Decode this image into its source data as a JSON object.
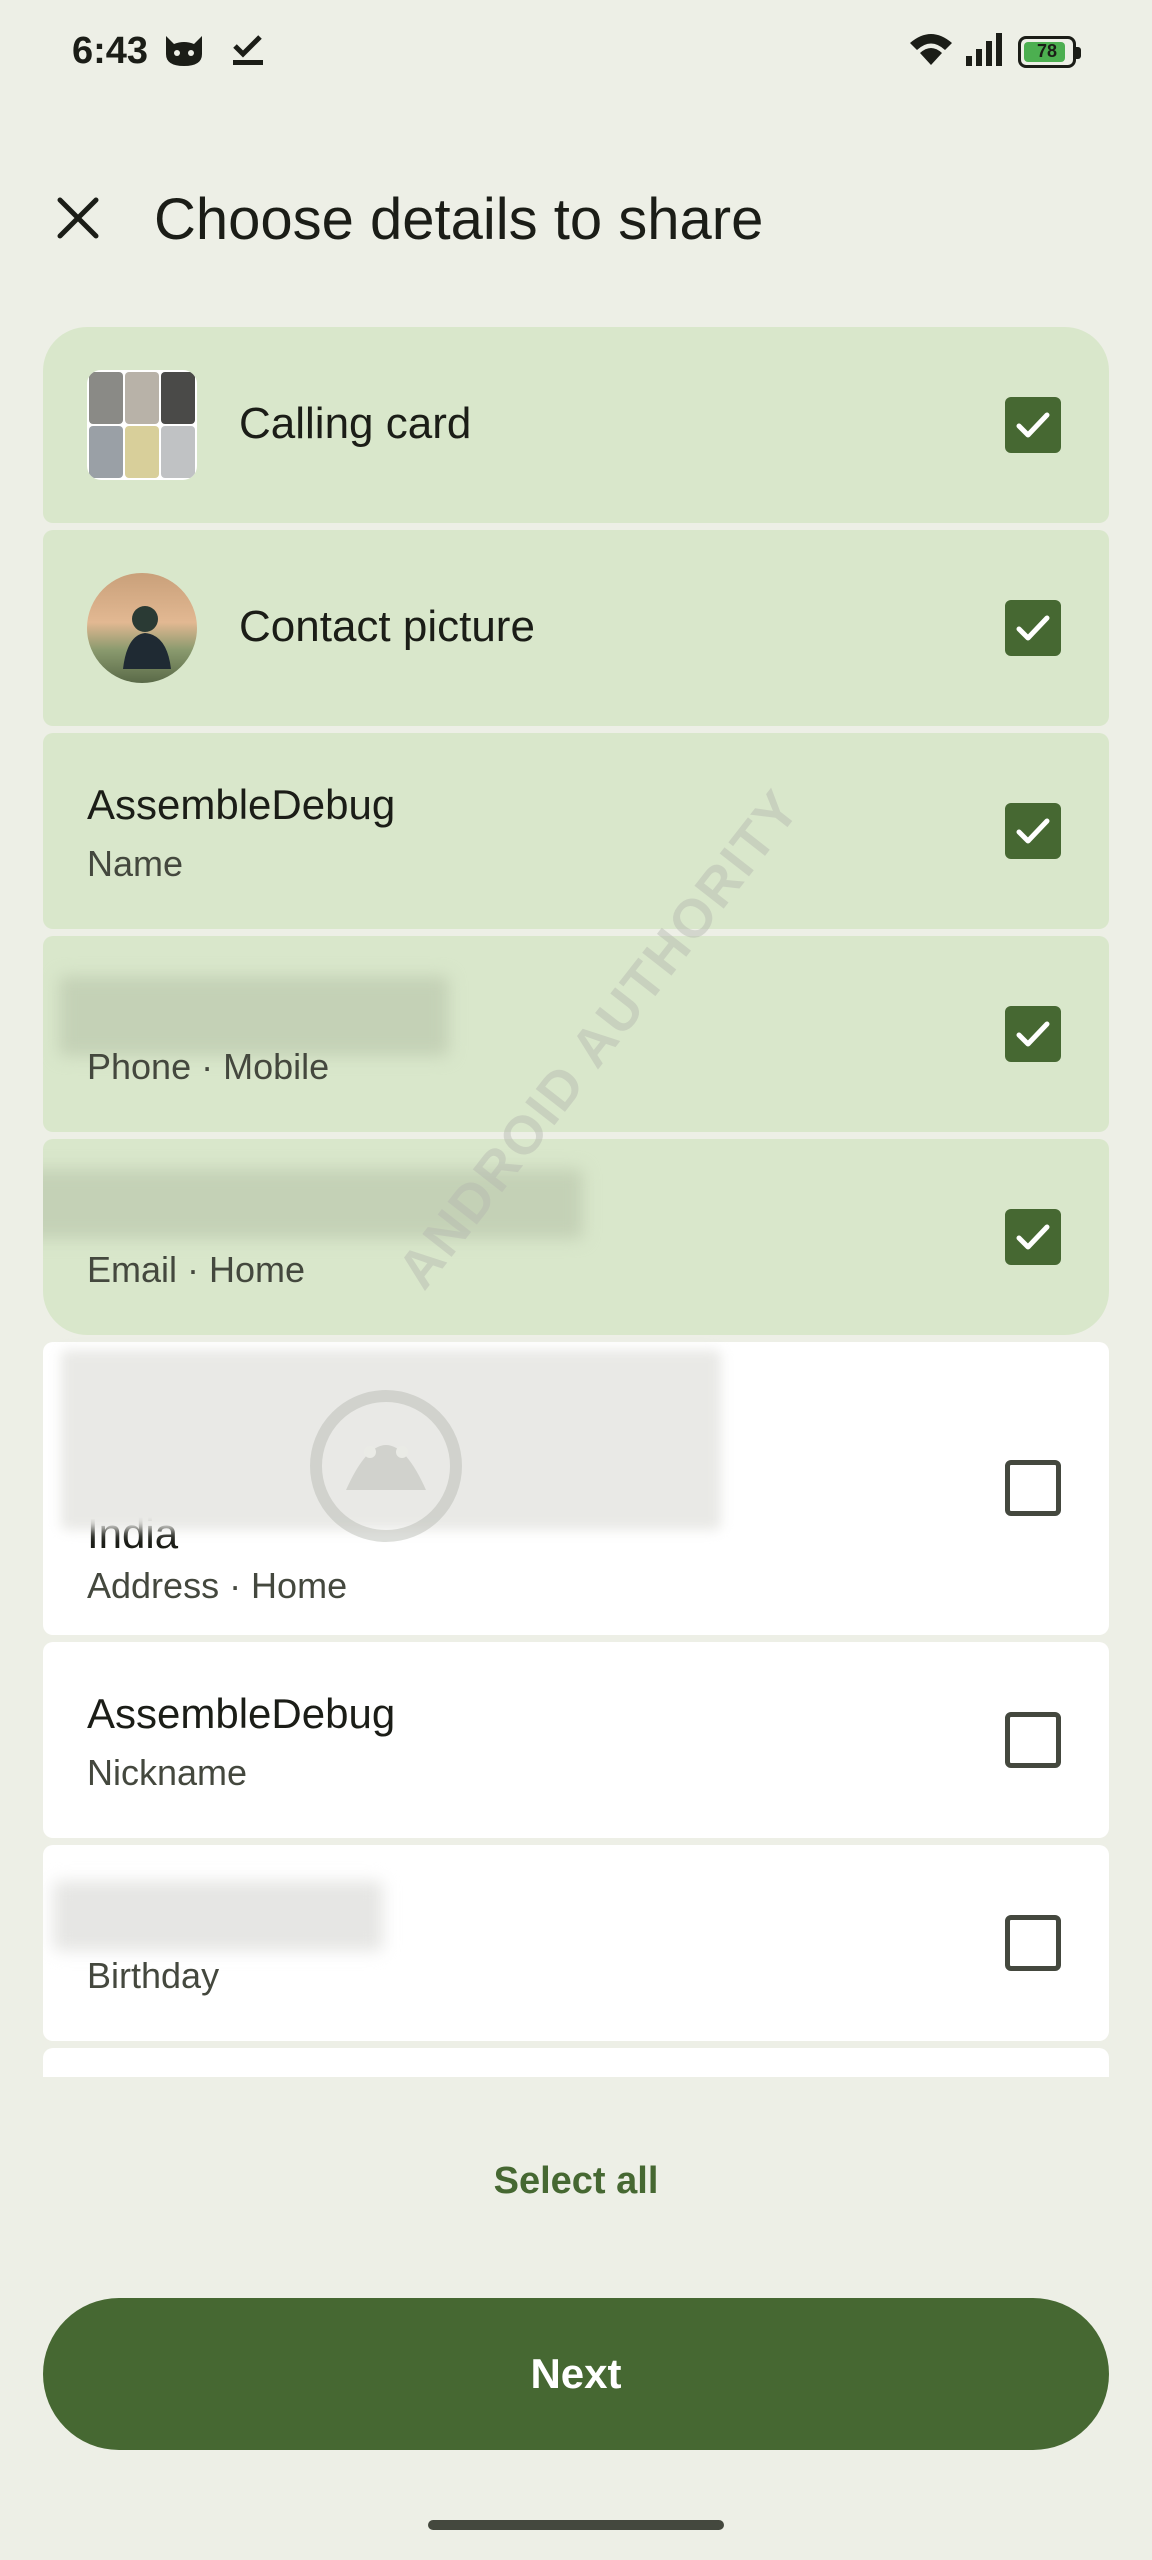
{
  "status_bar": {
    "time": "6:43",
    "battery_level": "78",
    "icons": [
      "cat-icon",
      "check-icon",
      "wifi-icon",
      "signal-icon",
      "battery-icon"
    ]
  },
  "header": {
    "title": "Choose details to share",
    "close_icon": "close-icon"
  },
  "items": [
    {
      "primary": "Calling card",
      "secondary": "",
      "checked": true
    },
    {
      "primary": "Contact picture",
      "secondary": "",
      "checked": true
    },
    {
      "primary": "AssembleDebug",
      "secondary": "Name",
      "checked": true
    },
    {
      "primary": "",
      "secondary": "Phone · Mobile",
      "checked": true
    },
    {
      "primary": "",
      "secondary": "Email · Home",
      "checked": true
    },
    {
      "primary": "India",
      "secondary": "Address · Home",
      "checked": false
    },
    {
      "primary": "AssembleDebug",
      "secondary": "Nickname",
      "checked": false
    },
    {
      "primary": "",
      "secondary": "Birthday",
      "checked": false
    }
  ],
  "watermark": {
    "text": "ANDROID AUTHORITY"
  },
  "footer": {
    "select_all_label": "Select all",
    "next_label": "Next"
  },
  "colors": {
    "background": "#edefe6",
    "selected_row": "#d9e7cb",
    "accent": "#466832"
  }
}
